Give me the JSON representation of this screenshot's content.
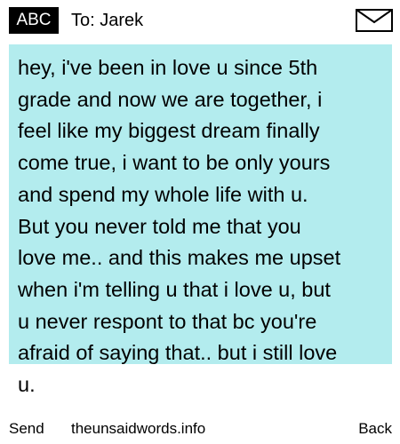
{
  "header": {
    "mode_badge": "ABC",
    "recipient": "To: Jarek",
    "icon": "envelope-icon"
  },
  "message": {
    "text": "hey, i've been in love u since 5th\ngrade and now we are together, i\nfeel like my biggest dream finally\ncome true, i want to be only yours\nand spend my whole life with u.\nBut you never told me that you\nlove me.. and this makes me upset\nwhen i'm telling u that i love u, but\nu never respont to that bc you're\nafraid of saying that.. but i still love\nu."
  },
  "softkeys": {
    "left": "Send",
    "center": "theunsaidwords.info",
    "right": "Back"
  },
  "colors": {
    "message_background": "#b3ecee",
    "badge_background": "#000000",
    "badge_text": "#ffffff"
  }
}
